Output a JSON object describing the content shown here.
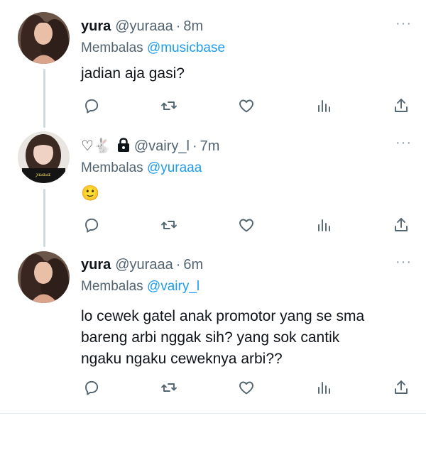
{
  "tweets": [
    {
      "name": "yura",
      "handle": "@yuraaa",
      "separator": "·",
      "time": "8m",
      "reply_prefix": "Membalas",
      "reply_to": "@musicbase",
      "text": "jadian aja gasi?"
    },
    {
      "name": "♡🐇",
      "lock_icon": "lock-icon",
      "handle": "@vairy_l",
      "separator": "·",
      "time": "7m",
      "reply_prefix": "Membalas",
      "reply_to": "@yuraaa",
      "text": "🙂"
    },
    {
      "name": "yura",
      "handle": "@yuraaa",
      "separator": "·",
      "time": "6m",
      "reply_prefix": "Membalas",
      "reply_to": "@vairy_l",
      "text_lines": [
        "lo cewek gatel anak promotor yang se sma",
        "bareng arbi nggak sih? yang sok cantik",
        "ngaku ngaku ceweknya arbi??"
      ]
    }
  ],
  "more_label": "···",
  "actions": [
    "reply-icon",
    "retweet-icon",
    "like-icon",
    "analytics-icon",
    "share-icon"
  ],
  "colors": {
    "mention": "#1d9bf0",
    "secondary_text": "#536471",
    "thread_line": "#cfd9de"
  }
}
